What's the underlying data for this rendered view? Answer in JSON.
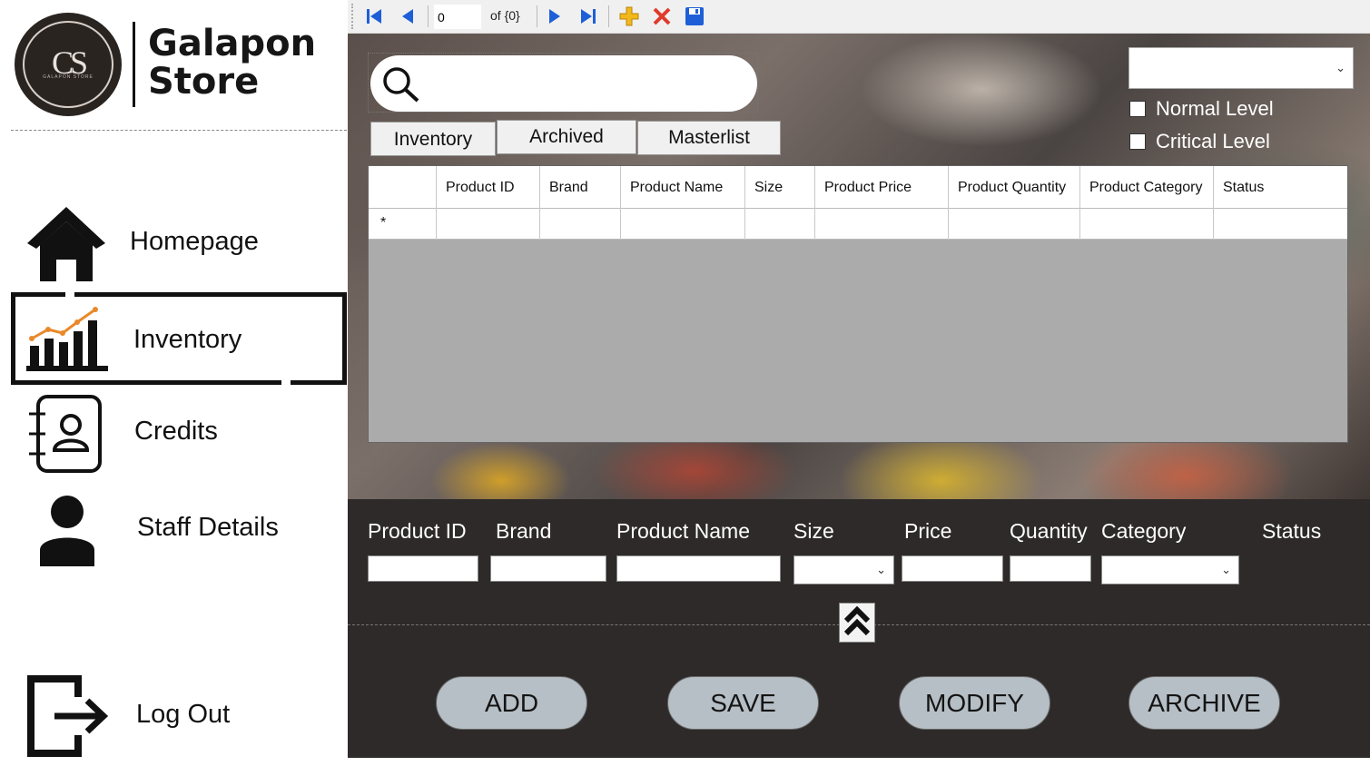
{
  "brand": {
    "logo_mark": "CS",
    "logo_small": "GALAPON STORE",
    "name_line1": "Galapon",
    "name_line2": "Store"
  },
  "sidebar": {
    "items": [
      {
        "id": "homepage",
        "label": "Homepage",
        "icon": "home-icon"
      },
      {
        "id": "inventory",
        "label": "Inventory",
        "icon": "chart-icon",
        "active": true
      },
      {
        "id": "credits",
        "label": "Credits",
        "icon": "contacts-book-icon"
      },
      {
        "id": "staff",
        "label": "Staff Details",
        "icon": "person-icon"
      },
      {
        "id": "logout",
        "label": "Log Out",
        "icon": "logout-icon"
      }
    ]
  },
  "toolbar": {
    "position": "0",
    "count_text": "of {0}"
  },
  "search": {
    "value": ""
  },
  "tabs": [
    {
      "label": "Inventory"
    },
    {
      "label": "Archived"
    },
    {
      "label": "Masterlist"
    }
  ],
  "filters": {
    "level_select_value": "",
    "normal_level": "Normal Level",
    "critical_level": "Critical Level"
  },
  "grid": {
    "columns": [
      "Product ID",
      "Brand",
      "Product Name",
      "Size",
      "Product Price",
      "Product Quantity",
      "Product Category",
      "Status"
    ],
    "new_row_marker": "*"
  },
  "form": {
    "labels": {
      "product_id": "Product ID",
      "brand": "Brand",
      "product_name": "Product Name",
      "size": "Size",
      "price": "Price",
      "quantity": "Quantity",
      "category": "Category",
      "status": "Status"
    }
  },
  "actions": {
    "add": "ADD",
    "save": "SAVE",
    "modify": "MODIFY",
    "archive": "ARCHIVE"
  },
  "colors": {
    "panel_bg": "#2d2a29",
    "button_bg": "#b6bfc6",
    "toolbar_icon_blue": "#1e5fd8",
    "add_icon": "#f2b81a",
    "delete_icon": "#e03a2a",
    "chart_accent": "#e8892b"
  }
}
